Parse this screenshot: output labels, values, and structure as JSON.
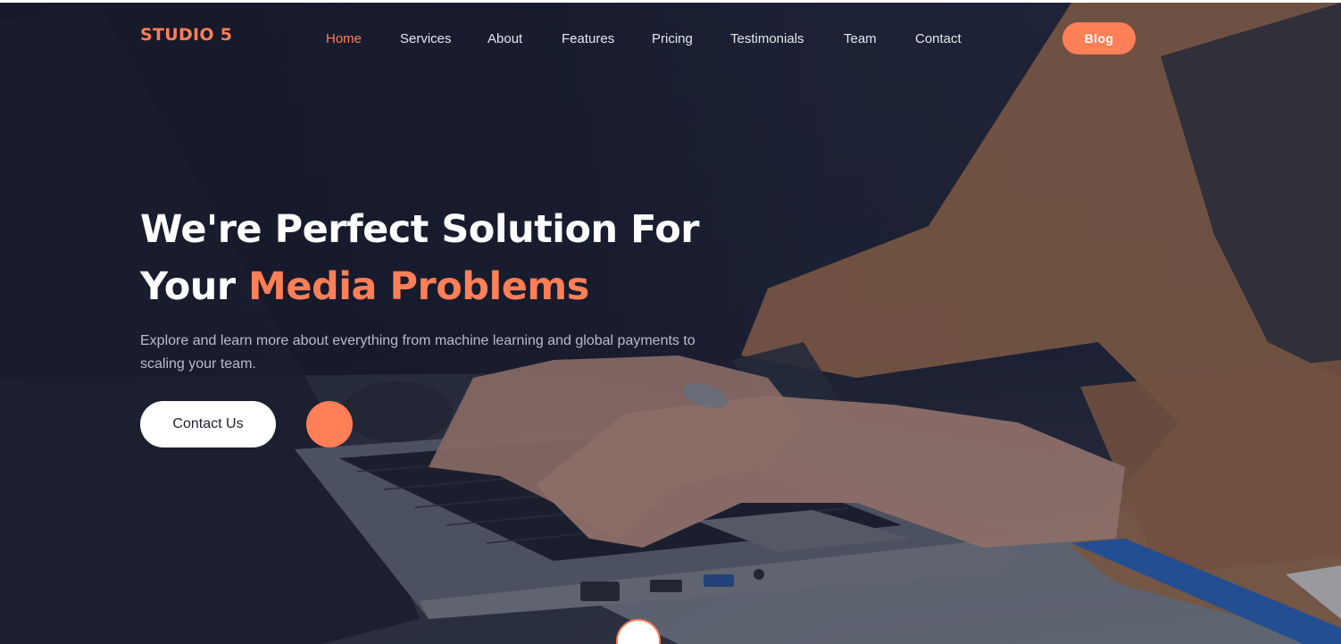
{
  "brand": {
    "name": "STUDIO 5"
  },
  "nav": {
    "items": [
      {
        "label": "Home",
        "active": true
      },
      {
        "label": "Services"
      },
      {
        "label": "About"
      },
      {
        "label": "Features"
      },
      {
        "label": "Pricing"
      },
      {
        "label": "Testimonials"
      },
      {
        "label": "Team"
      },
      {
        "label": "Contact"
      }
    ],
    "cta_label": "Blog"
  },
  "hero": {
    "headline_line1": "We're Perfect Solution For",
    "headline_line2_prefix": "Your ",
    "headline_line2_accent": "Media Problems",
    "subtext": "Explore and learn more about everything from machine learning and global payments to scaling your team.",
    "contact_button_label": "Contact Us"
  },
  "colors": {
    "accent": "#ff7f57",
    "overlay": "#1c1f33",
    "text_light": "#ffffff",
    "text_muted": "#b9bcc8"
  }
}
